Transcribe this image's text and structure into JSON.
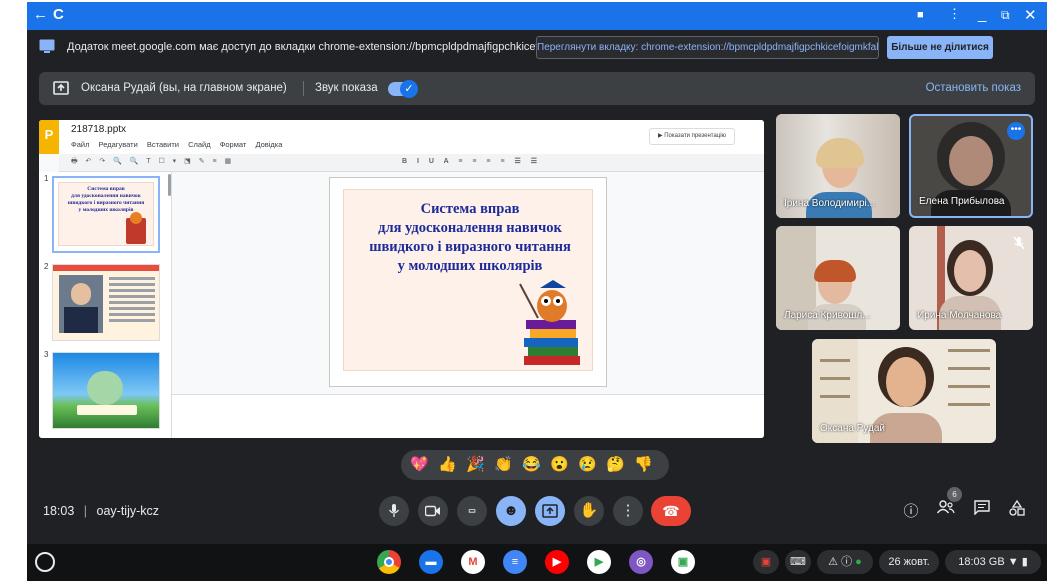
{
  "notice": {
    "text": "Додаток meet.google.com має доступ до вкладки chrome-extension://bpmcpldpdmajfigpchkicefoigmkfalc",
    "view_tab_button": "Переглянути вкладку: chrome-extension://bpmcpldpdmajfigpchkicefoigmkfalc",
    "stop_sharing_button": "Більше не ділитися"
  },
  "presenting": {
    "name": "Оксана Рудай (вы, на главном экране)",
    "sound_label": "Звук показа",
    "sound_on": true,
    "stop_button": "Остановить показ"
  },
  "slides": {
    "file_name": "218718.pptx",
    "logo_letter": "P",
    "menu": [
      "Файл",
      "Редагувати",
      "Вставити",
      "Слайд",
      "Формат",
      "Довідка"
    ],
    "present_button": "Показати презентацію",
    "thumbnail_numbers": [
      "1",
      "2",
      "3"
    ],
    "thumb1_title": [
      "Система вправ",
      "для удосконалення навичок",
      "швидкого і виразного читання",
      "у молодших школярів"
    ],
    "slide_title": [
      "Система вправ",
      "для удосконалення навичок",
      "швидкого і виразного читання",
      "у молодших школярів"
    ]
  },
  "participants": [
    {
      "name": "Ірина Володимирі...",
      "color": "#c8a88e"
    },
    {
      "name": "Елена Прибылова",
      "color": "#3b3a3a"
    },
    {
      "name": "Лариса Кривошл...",
      "color": "#d9d3cb"
    },
    {
      "name": "Ирина Молчанова",
      "color": "#d8c9c0"
    },
    {
      "name": "Оксана Рудай",
      "color": "#cdbfa8"
    }
  ],
  "reactions": [
    "💖",
    "👍",
    "🎉",
    "👏",
    "😂",
    "😮",
    "😢",
    "🤔",
    "👎"
  ],
  "meeting": {
    "time": "18:03",
    "separator": "|",
    "code": "oay-tijy-kcz",
    "participant_count": "6"
  },
  "shelf": {
    "date": "26 жовт.",
    "time_status": "18:03 GB"
  },
  "colors": {
    "accent": "#1a73e8",
    "meet_bg": "#202124",
    "end_call": "#ea4335",
    "link": "#8ab4f8"
  }
}
